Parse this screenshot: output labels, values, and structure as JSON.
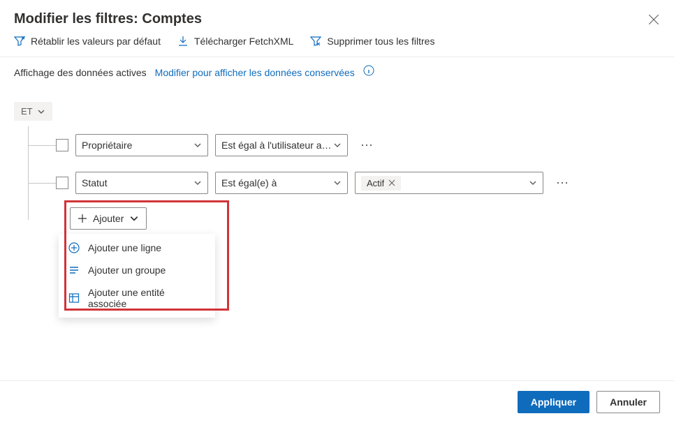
{
  "header": {
    "title": "Modifier les filtres: Comptes"
  },
  "toolbar": {
    "reset": "Rétablir les valeurs par défaut",
    "download": "Télécharger FetchXML",
    "clear": "Supprimer tous les filtres"
  },
  "subbar": {
    "static": "Affichage des données actives",
    "link": "Modifier pour afficher les données conservées"
  },
  "root_group": "ET",
  "rows": [
    {
      "field": "Propriétaire",
      "operator": "Est égal à l'utilisateur ac…",
      "value_tag": null
    },
    {
      "field": "Statut",
      "operator": "Est égal(e) à",
      "value_tag": "Actif"
    }
  ],
  "add": {
    "button": "Ajouter",
    "menu": {
      "row": "Ajouter une ligne",
      "group": "Ajouter un groupe",
      "related": "Ajouter une entité associée"
    }
  },
  "footer": {
    "apply": "Appliquer",
    "cancel": "Annuler"
  }
}
